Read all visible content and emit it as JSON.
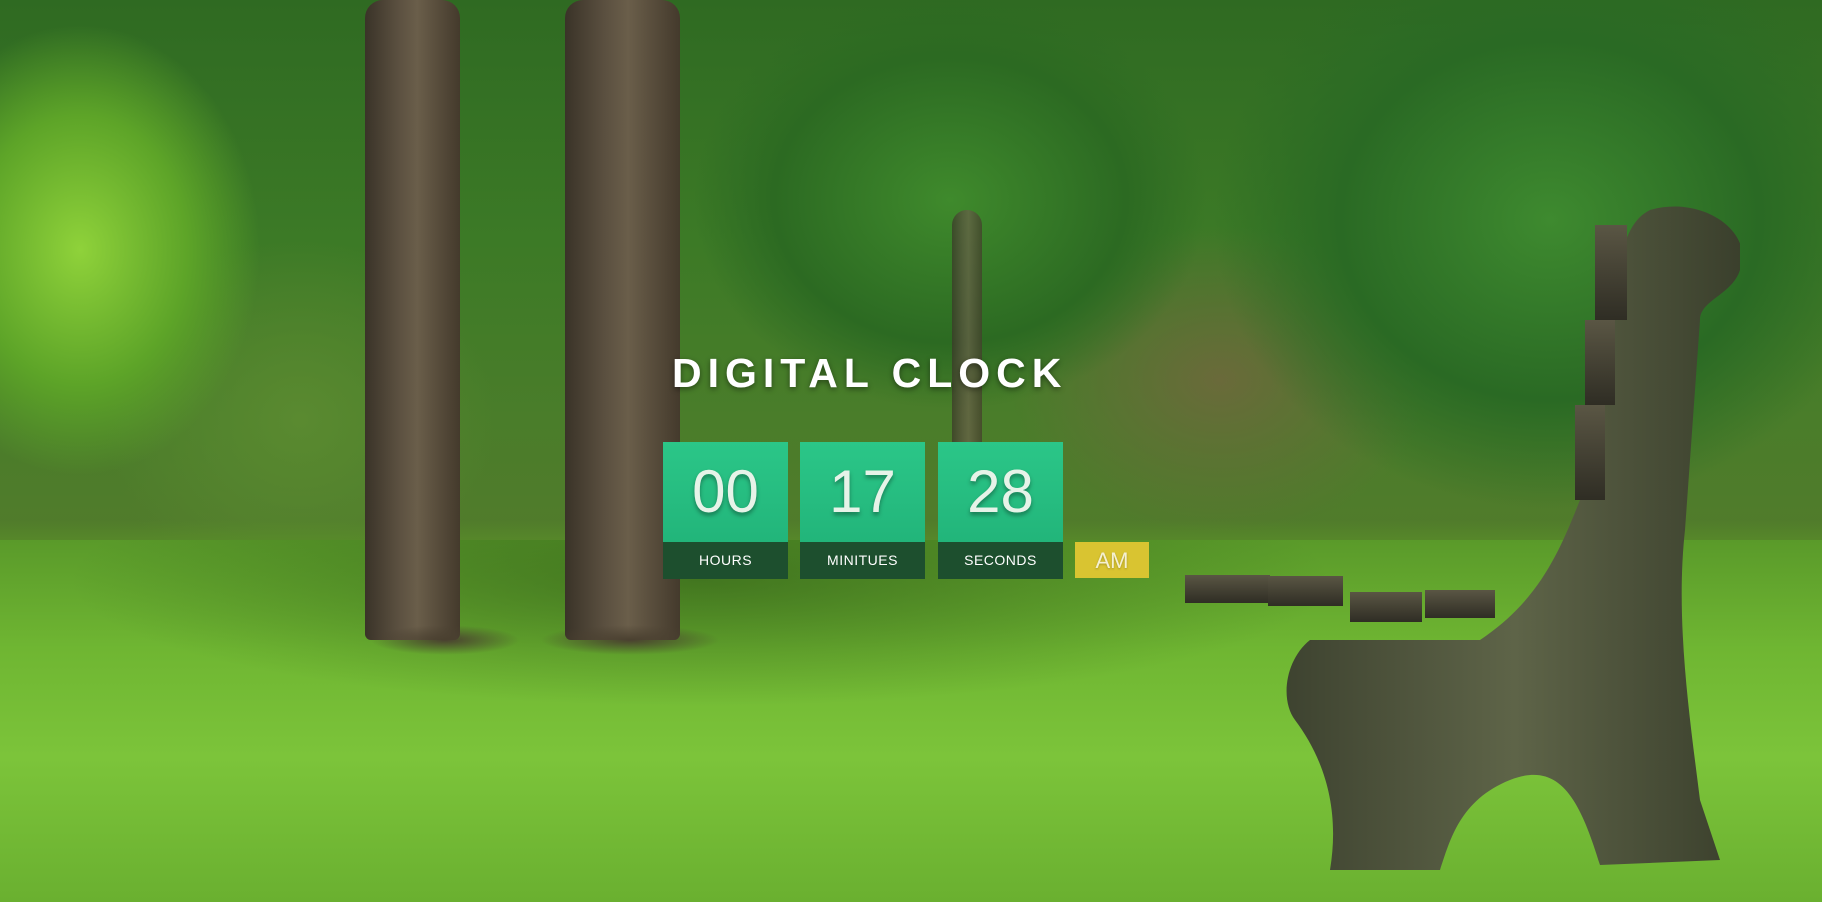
{
  "clock": {
    "title": "DIGITAL CLOCK",
    "hours": {
      "value": "00",
      "label": "HOURS"
    },
    "minutes": {
      "value": "17",
      "label": "MINITUES"
    },
    "seconds": {
      "value": "28",
      "label": "SECONDS"
    },
    "meridiem": "AM"
  },
  "colors": {
    "digit_tile": "#2bc688",
    "label_bar": "#1d4f2e",
    "meridiem_badge": "#d9c431",
    "title_text": "#ffffff"
  }
}
